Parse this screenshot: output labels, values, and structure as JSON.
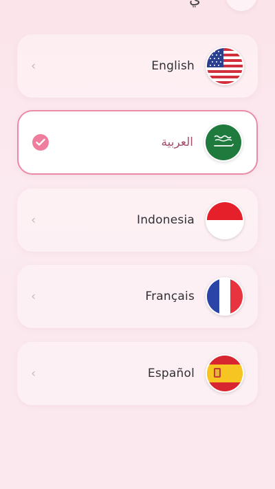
{
  "header": {
    "partial_title": "ي"
  },
  "languages": [
    {
      "label": "English",
      "flag": "us-flag-icon",
      "selected": false
    },
    {
      "label": "العربية",
      "flag": "saudi-flag-icon",
      "selected": true
    },
    {
      "label": "Indonesia",
      "flag": "indonesia-flag-icon",
      "selected": false
    },
    {
      "label": "Français",
      "flag": "france-flag-icon",
      "selected": false
    },
    {
      "label": "Español",
      "flag": "spain-flag-icon",
      "selected": false
    }
  ],
  "colors": {
    "accent": "#ef7d9c",
    "selected_border": "#ec8aa6",
    "selected_text": "#a54f6a"
  }
}
